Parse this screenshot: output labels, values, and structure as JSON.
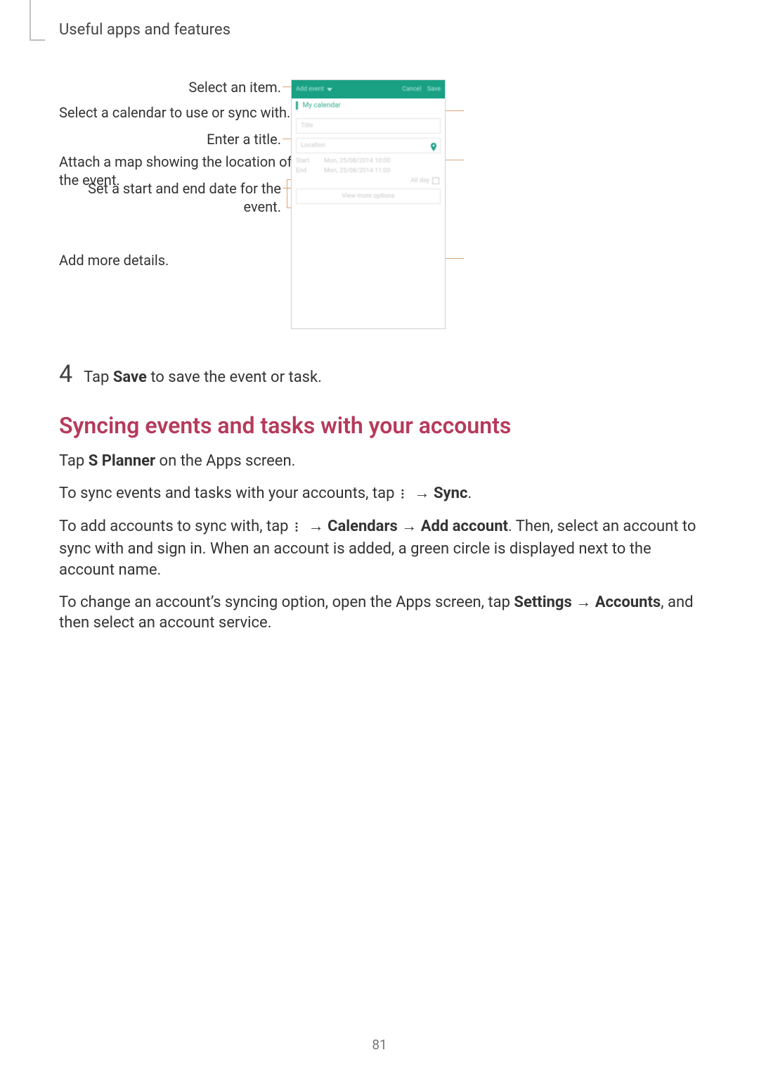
{
  "header": {
    "section": "Useful apps and features"
  },
  "figure": {
    "left_labels": {
      "select_item": "Select an item.",
      "enter_title": "Enter a title.",
      "set_dates": "Set a start and end date for the event."
    },
    "right_labels": {
      "select_calendar": "Select a calendar to use or sync with.",
      "attach_map": "Attach a map showing the location of the event.",
      "add_details": "Add more details."
    },
    "phone": {
      "top_left": "Add event",
      "top_cancel": "Cancel",
      "top_save": "Save",
      "calendar_row": "My calendar",
      "title_placeholder": "Title",
      "location_placeholder": "Location",
      "start_label": "Start",
      "start_value": "Mon, 25/08/2014  10:00",
      "end_label": "End",
      "end_value": "Mon, 25/08/2014  11:00",
      "all_day": "All day",
      "more_options": "View more options"
    }
  },
  "step4": {
    "num": "4",
    "text_before": "Tap ",
    "text_bold": "Save",
    "text_after": " to save the event or task."
  },
  "section_heading": "Syncing events and tasks with your accounts",
  "p1": {
    "pre": "Tap ",
    "bold": "S Planner",
    "post": " on the Apps screen."
  },
  "p2": {
    "pre": "To sync events and tasks with your accounts, tap ",
    "arr": " → ",
    "bold": "Sync",
    "post": "."
  },
  "p3": {
    "pre": "To add accounts to sync with, tap ",
    "arr1": " → ",
    "bold1": "Calendars",
    "arr2": " → ",
    "bold2": "Add account",
    "post": ". Then, select an account to sync with and sign in. When an account is added, a green circle is displayed next to the account name."
  },
  "p4": {
    "pre": "To change an account’s syncing option, open the Apps screen, tap ",
    "bold1": "Settings",
    "arr": " → ",
    "bold2": "Accounts",
    "post": ", and then select an account service."
  },
  "page_number": "81"
}
